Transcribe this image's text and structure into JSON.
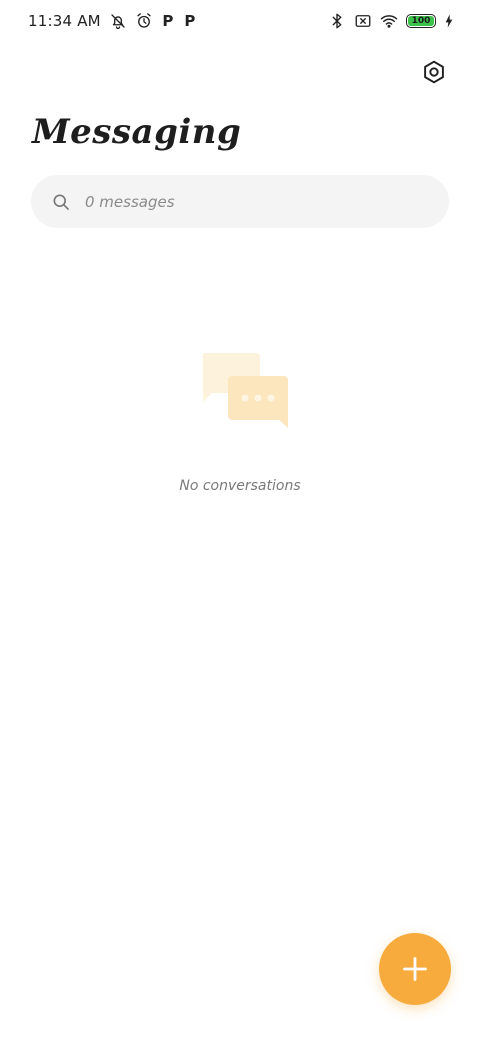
{
  "status_bar": {
    "time": "11:34 AM",
    "left_icons": [
      "notifications-off-icon",
      "alarm-icon",
      "p-app-icon",
      "p-app-icon"
    ],
    "p_glyph": "P",
    "right_icons": [
      "bluetooth-icon",
      "no-sim-icon",
      "wifi-icon",
      "battery-icon",
      "charging-icon"
    ],
    "battery_level": "100",
    "battery_fraction": 1.0,
    "battery_color": "#3cc14a"
  },
  "header": {
    "title": "Messaging",
    "settings_icon": "settings-hexagon-icon"
  },
  "search": {
    "placeholder": "0 messages",
    "icon": "search-icon"
  },
  "empty_state": {
    "illustration": "chat-bubbles-icon",
    "message": "No conversations"
  },
  "fab": {
    "icon": "plus-icon",
    "color": "#f6ab3c"
  }
}
